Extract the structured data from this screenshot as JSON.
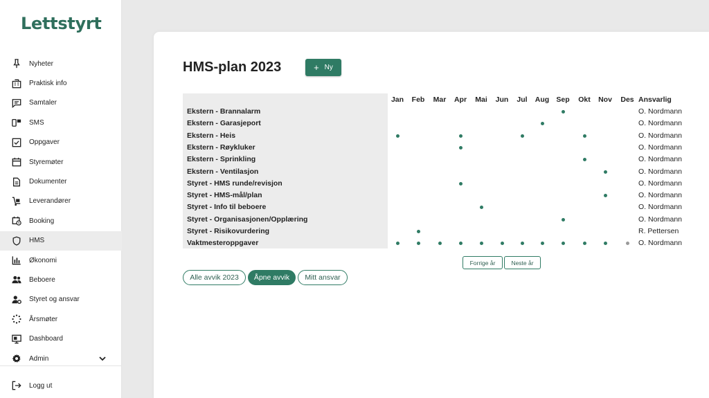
{
  "app": {
    "logo": "Lettstyrt"
  },
  "sidebar": {
    "items": [
      {
        "label": "Nyheter",
        "icon": "pin-icon"
      },
      {
        "label": "Praktisk info",
        "icon": "building-icon"
      },
      {
        "label": "Samtaler",
        "icon": "chat-icon"
      },
      {
        "label": "SMS",
        "icon": "phone-icon"
      },
      {
        "label": "Oppgaver",
        "icon": "checkbox-icon"
      },
      {
        "label": "Styremøter",
        "icon": "calendar-icon"
      },
      {
        "label": "Dokumenter",
        "icon": "document-icon"
      },
      {
        "label": "Leverandører",
        "icon": "dolly-icon"
      },
      {
        "label": "Booking",
        "icon": "calendar-clock-icon"
      },
      {
        "label": "HMS",
        "icon": "shield-icon"
      },
      {
        "label": "Økonomi",
        "icon": "bar-chart-icon"
      },
      {
        "label": "Beboere",
        "icon": "people-icon"
      },
      {
        "label": "Styret og ansvar",
        "icon": "user-gear-icon"
      },
      {
        "label": "Årsmøter",
        "icon": "dotted-circle-icon"
      },
      {
        "label": "Dashboard",
        "icon": "monitor-icon"
      },
      {
        "label": "Admin",
        "icon": "gear-icon"
      }
    ],
    "active": "HMS",
    "logout": "Logg ut"
  },
  "main": {
    "title": "HMS-plan 2023",
    "new_button": "Ny",
    "months": [
      "Jan",
      "Feb",
      "Mar",
      "Apr",
      "Mai",
      "Jun",
      "Jul",
      "Aug",
      "Sep",
      "Okt",
      "Nov",
      "Des"
    ],
    "responsible_header": "Ansvarlig",
    "rows": [
      {
        "label": "Ekstern - Brannalarm",
        "responsible": "O. Nordmann",
        "months": [
          9
        ]
      },
      {
        "label": "Ekstern - Garasjeport",
        "responsible": "O. Nordmann",
        "months": [
          8
        ]
      },
      {
        "label": "Ekstern - Heis",
        "responsible": "O. Nordmann",
        "months": [
          1,
          4,
          7,
          10
        ]
      },
      {
        "label": "Ekstern - Røykluker",
        "responsible": "O. Nordmann",
        "months": [
          4
        ]
      },
      {
        "label": "Ekstern - Sprinkling",
        "responsible": "O. Nordmann",
        "months": [
          10
        ]
      },
      {
        "label": "Ekstern - Ventilasjon",
        "responsible": "O. Nordmann",
        "months": [
          11
        ]
      },
      {
        "label": "Styret - HMS runde/revisjon",
        "responsible": "O. Nordmann",
        "months": [
          4
        ]
      },
      {
        "label": "Styret - HMS-mål/plan",
        "responsible": "O. Nordmann",
        "months": [
          11
        ]
      },
      {
        "label": "Styret - Info til beboere",
        "responsible": "O. Nordmann",
        "months": [
          5
        ]
      },
      {
        "label": "Styret - Organisasjonen/Opplæring",
        "responsible": "O. Nordmann",
        "months": [
          9
        ]
      },
      {
        "label": "Styret - Risikovurdering",
        "responsible": "R. Pettersen",
        "months": [
          2
        ]
      },
      {
        "label": "Vaktmesteroppgaver",
        "responsible": "O. Nordmann",
        "months": [
          1,
          2,
          3,
          4,
          5,
          6,
          7,
          8,
          9,
          10,
          11,
          12
        ],
        "muted_months": [
          12
        ]
      }
    ],
    "pager": {
      "prev": "Forrige år",
      "next": "Neste år"
    },
    "filters": [
      {
        "label": "Alle avvik 2023",
        "active": false
      },
      {
        "label": "Åpne avvik",
        "active": true
      },
      {
        "label": "Mitt ansvar",
        "active": false
      }
    ]
  },
  "colors": {
    "accent": "#2f7b64",
    "logo_roof": "#d9663f",
    "dot": "#2f7b64",
    "dot_muted": "#9a9a9a"
  }
}
